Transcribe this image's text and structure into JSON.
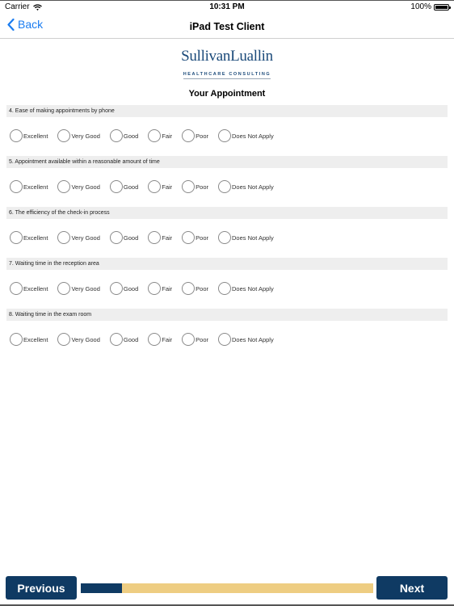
{
  "statusbar": {
    "carrier": "Carrier",
    "time": "10:31 PM",
    "battery": "100%"
  },
  "navbar": {
    "back_label": "Back",
    "title": "iPad Test Client"
  },
  "logo": {
    "main": "SullivanLuallin",
    "sub": "HEALTHCARE CONSULTING"
  },
  "section_title": "Your Appointment",
  "questions": [
    {
      "label": "4. Ease of making appointments by phone"
    },
    {
      "label": "5. Appointment available within a reasonable amount of time"
    },
    {
      "label": "6. The efficiency of the check-in process"
    },
    {
      "label": "7. Waiting time in the reception area"
    },
    {
      "label": "8. Waiting time in the exam room"
    }
  ],
  "options": [
    "Excellent",
    "Very Good",
    "Good",
    "Fair",
    "Poor",
    "Does Not Apply"
  ],
  "footer": {
    "previous_label": "Previous",
    "next_label": "Next",
    "progress_fraction": 0.14
  },
  "colors": {
    "brand_navy": "#0f3a63",
    "progress_track": "#eecd82",
    "link_blue": "#1a7cf0"
  }
}
